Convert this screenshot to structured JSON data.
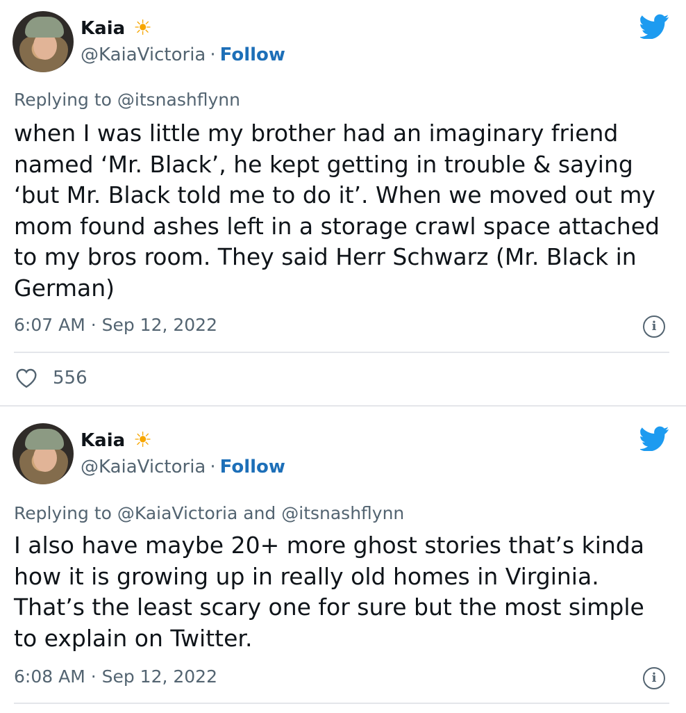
{
  "colors": {
    "accent": "#1d9bf0",
    "follow": "#1d6fb8",
    "muted": "#536471",
    "text": "#0f1419"
  },
  "tweets": [
    {
      "author_name": "Kaia",
      "name_emoji": "☀",
      "handle": "@KaiaVictoria",
      "separator": "·",
      "follow_label": "Follow",
      "replying_to": "Replying to @itsnashflynn",
      "text": "when I was little my brother had an imaginary friend named ‘Mr. Black’, he kept getting in trouble & saying ‘but Mr. Black told me to do it’. When we moved out my mom found ashes left in a storage crawl space attached to my bros room. They said Herr Schwarz (Mr. Black in German)",
      "timestamp": "6:07 AM · Sep 12, 2022",
      "info_glyph": "i",
      "likes": "556"
    },
    {
      "author_name": "Kaia",
      "name_emoji": "☀",
      "handle": "@KaiaVictoria",
      "separator": "·",
      "follow_label": "Follow",
      "replying_to": "Replying to @KaiaVictoria and @itsnashflynn",
      "text": "I also have maybe 20+ more ghost stories that’s kinda how it is growing up in really old homes in Virginia. That’s the least scary one for sure but the most simple to explain on Twitter.",
      "timestamp": "6:08 AM · Sep 12, 2022",
      "info_glyph": "i"
    }
  ]
}
